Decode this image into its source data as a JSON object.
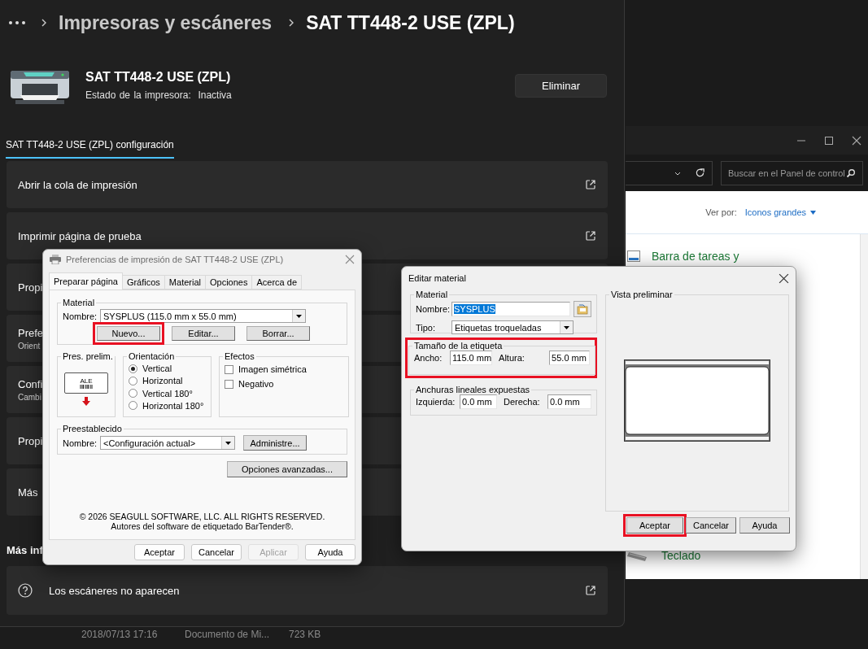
{
  "background_list": {
    "row": {
      "date": "2018/07/13 17:16",
      "type": "Documento de Mi...",
      "size": "723 KB"
    }
  },
  "control_panel": {
    "search_placeholder": "Buscar en el Panel de control",
    "view_label": "Ver por:",
    "view_value": "Iconos grandes",
    "items": [
      {
        "label": "Barra de tareas y",
        "kind": "taskbar"
      },
      {
        "label": "Teclado",
        "kind": "keyboard"
      }
    ]
  },
  "settings": {
    "breadcrumb": [
      "Impresoras y escáneres",
      "SAT TT448-2 USE (ZPL)"
    ],
    "printer": {
      "name": "SAT TT448-2 USE (ZPL)",
      "status_label": "Estado de la impresora:",
      "status": "Inactiva"
    },
    "remove_button": "Eliminar",
    "tab": {
      "label": "SAT TT448-2 USE (ZPL) configuración",
      "selected": true
    },
    "cards": [
      {
        "title": "Abrir la cola de impresión",
        "kind": "link"
      },
      {
        "title": "Imprimir página de prueba",
        "kind": "link"
      },
      {
        "title": "Propi",
        "kind": "covered"
      },
      {
        "title": "Prefe",
        "subtitle": "Orient",
        "kind": "covered"
      },
      {
        "title": "Confi",
        "subtitle": "Cambi",
        "kind": "covered"
      },
      {
        "title": "Propi",
        "kind": "covered"
      },
      {
        "title": "Más",
        "kind": "covered"
      }
    ],
    "section": "Más inf",
    "help_card": {
      "title": "Los escáneres no aparecen"
    }
  },
  "preferences_dialog": {
    "title": "Preferencias de impresión de SAT TT448-2 USE (ZPL)",
    "tabs": [
      {
        "label": "Preparar página",
        "selected": true
      },
      {
        "label": "Gráficos",
        "selected": false
      },
      {
        "label": "Material",
        "selected": false
      },
      {
        "label": "Opciones",
        "selected": false
      },
      {
        "label": "Acerca de",
        "selected": false
      }
    ],
    "material": {
      "legend": "Material",
      "name_label": "Nombre:",
      "name_value": "SYSPLUS (115.0 mm x 55.0 mm)",
      "buttons": [
        {
          "label": "Nuevo...",
          "highlighted": true
        },
        {
          "label": "Editar...",
          "highlighted": false
        },
        {
          "label": "Borrar...",
          "highlighted": false
        }
      ]
    },
    "preview": {
      "legend": "Pres. prelim.",
      "label_text": "ALE"
    },
    "orientation": {
      "legend": "Orientación",
      "options": [
        {
          "label": "Vertical",
          "selected": true
        },
        {
          "label": "Horizontal",
          "selected": false
        },
        {
          "label": "Vertical 180°",
          "selected": false
        },
        {
          "label": "Horizontal 180°",
          "selected": false
        }
      ]
    },
    "effects": {
      "legend": "Efectos",
      "options": [
        {
          "label": "Imagen simétrica",
          "checked": false
        },
        {
          "label": "Negativo",
          "checked": false
        }
      ]
    },
    "preset": {
      "legend": "Preestablecido",
      "name_label": "Nombre:",
      "value": "<Configuración actual>",
      "button": "Administre..."
    },
    "advanced_button": "Opciones avanzadas...",
    "copyright": [
      "© 2026 SEAGULL SOFTWARE, LLC. ALL RIGHTS RESERVED.",
      "Autores del software de etiquetado BarTender®."
    ],
    "buttons": [
      {
        "label": "Aceptar",
        "disabled": false
      },
      {
        "label": "Cancelar",
        "disabled": false
      },
      {
        "label": "Aplicar",
        "disabled": true
      },
      {
        "label": "Ayuda",
        "disabled": false
      }
    ]
  },
  "edit_dialog": {
    "title": "Editar material",
    "material": {
      "legend": "Material",
      "name_label": "Nombre:",
      "name_value": "SYSPLUS",
      "name_text_selected": true,
      "type_label": "Tipo:",
      "type_value": "Etiquetas troqueladas"
    },
    "size": {
      "legend": "Tamaño de la etiqueta",
      "highlighted": true,
      "width_label": "Ancho:",
      "width_value": "115.0 mm",
      "height_label": "Altura:",
      "height_value": "55.0 mm"
    },
    "liner": {
      "legend": "Anchuras lineales expuestas",
      "left_label": "Izquierda:",
      "left_value": "0.0 mm",
      "right_label": "Derecha:",
      "right_value": "0.0 mm"
    },
    "preview_legend": "Vista preliminar",
    "buttons": [
      {
        "label": "Aceptar",
        "highlighted": true
      },
      {
        "label": "Cancelar",
        "highlighted": false
      },
      {
        "label": "Ayuda",
        "highlighted": false
      }
    ]
  }
}
